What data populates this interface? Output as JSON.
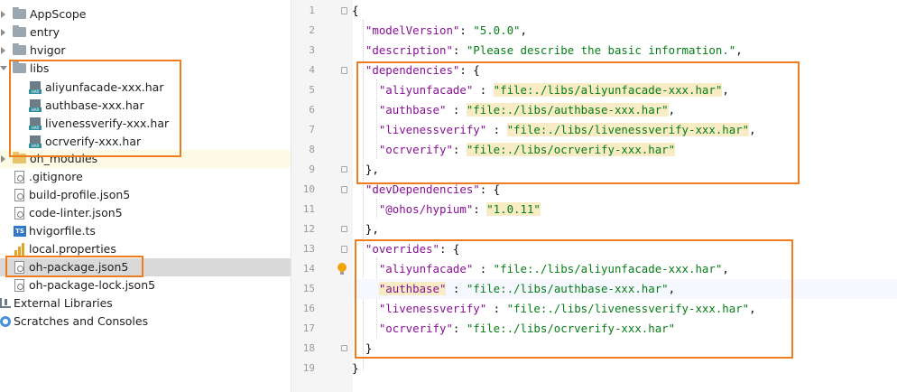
{
  "project_tree": {
    "items": [
      {
        "label": "AppScope",
        "icon": "folder-icon",
        "expander": "collapsed"
      },
      {
        "label": "entry",
        "icon": "folder-icon",
        "expander": "collapsed"
      },
      {
        "label": "hvigor",
        "icon": "folder-icon",
        "expander": "collapsed"
      },
      {
        "label": "libs",
        "icon": "folder-icon",
        "expander": "expanded"
      },
      {
        "label": "aliyunfacade-xxx.har",
        "icon": "har-file-icon"
      },
      {
        "label": "authbase-xxx.har",
        "icon": "har-file-icon"
      },
      {
        "label": "livenessverify-xxx.har",
        "icon": "har-file-icon"
      },
      {
        "label": "ocrverify-xxx.har",
        "icon": "har-file-icon"
      },
      {
        "label": "oh_modules",
        "icon": "folder-icon",
        "expander": "collapsed"
      },
      {
        "label": ".gitignore",
        "icon": "config-file-icon"
      },
      {
        "label": "build-profile.json5",
        "icon": "config-file-icon"
      },
      {
        "label": "code-linter.json5",
        "icon": "config-file-icon"
      },
      {
        "label": "hvigorfile.ts",
        "icon": "typescript-file-icon"
      },
      {
        "label": "local.properties",
        "icon": "properties-file-icon"
      },
      {
        "label": "oh-package.json5",
        "icon": "config-file-icon",
        "selected": true
      },
      {
        "label": "oh-package-lock.json5",
        "icon": "config-file-icon"
      },
      {
        "label": "External Libraries",
        "icon": "libraries-icon"
      },
      {
        "label": "Scratches and Consoles",
        "icon": "scratches-icon"
      }
    ]
  },
  "editor": {
    "line_numbers": [
      "1",
      "2",
      "3",
      "4",
      "5",
      "6",
      "7",
      "8",
      "9",
      "10",
      "11",
      "12",
      "13",
      "14",
      "15",
      "16",
      "17",
      "18",
      "19"
    ],
    "lines": [
      {
        "tokens": [
          {
            "t": "p",
            "v": "{"
          }
        ]
      },
      {
        "tokens": [
          {
            "t": "p",
            "v": "  "
          },
          {
            "t": "k",
            "v": "\"modelVersion\""
          },
          {
            "t": "p",
            "v": ": "
          },
          {
            "t": "s",
            "v": "\"5.0.0\""
          },
          {
            "t": "p",
            "v": ","
          }
        ]
      },
      {
        "tokens": [
          {
            "t": "p",
            "v": "  "
          },
          {
            "t": "k",
            "v": "\"description\""
          },
          {
            "t": "p",
            "v": ": "
          },
          {
            "t": "s",
            "v": "\"Please describe the basic information.\""
          },
          {
            "t": "p",
            "v": ","
          }
        ]
      },
      {
        "tokens": [
          {
            "t": "p",
            "v": "  "
          },
          {
            "t": "k",
            "v": "\"dependencies\""
          },
          {
            "t": "p",
            "v": ": {"
          }
        ]
      },
      {
        "tokens": [
          {
            "t": "p",
            "v": "    "
          },
          {
            "t": "k",
            "v": "\"aliyunfacade\""
          },
          {
            "t": "p",
            "v": " : "
          },
          {
            "t": "s",
            "v": "\"file:./libs/aliyunfacade-xxx.har\"",
            "h": true
          },
          {
            "t": "p",
            "v": ","
          }
        ]
      },
      {
        "tokens": [
          {
            "t": "p",
            "v": "    "
          },
          {
            "t": "k",
            "v": "\"authbase\""
          },
          {
            "t": "p",
            "v": " : "
          },
          {
            "t": "s",
            "v": "\"file:./libs/authbase-xxx.har\"",
            "h": true
          },
          {
            "t": "p",
            "v": ","
          }
        ]
      },
      {
        "tokens": [
          {
            "t": "p",
            "v": "    "
          },
          {
            "t": "k",
            "v": "\"livenessverify\""
          },
          {
            "t": "p",
            "v": " : "
          },
          {
            "t": "s",
            "v": "\"file:./libs/livenessverify-xxx.har\"",
            "h": true
          },
          {
            "t": "p",
            "v": ","
          }
        ]
      },
      {
        "tokens": [
          {
            "t": "p",
            "v": "    "
          },
          {
            "t": "k",
            "v": "\"ocrverify\""
          },
          {
            "t": "p",
            "v": ": "
          },
          {
            "t": "s",
            "v": "\"file:./libs/ocrverify-xxx.har\"",
            "h": true
          }
        ]
      },
      {
        "tokens": [
          {
            "t": "p",
            "v": "  },"
          }
        ]
      },
      {
        "tokens": [
          {
            "t": "p",
            "v": "  "
          },
          {
            "t": "k",
            "v": "\"devDependencies\""
          },
          {
            "t": "p",
            "v": ": {"
          }
        ]
      },
      {
        "tokens": [
          {
            "t": "p",
            "v": "    "
          },
          {
            "t": "k",
            "v": "\"@ohos/hypium\""
          },
          {
            "t": "p",
            "v": ": "
          },
          {
            "t": "s",
            "v": "\"1.0.11\"",
            "h": true
          }
        ]
      },
      {
        "tokens": [
          {
            "t": "p",
            "v": "  },"
          }
        ]
      },
      {
        "tokens": [
          {
            "t": "p",
            "v": "  "
          },
          {
            "t": "k",
            "v": "\"overrides\""
          },
          {
            "t": "p",
            "v": ": {"
          }
        ]
      },
      {
        "tokens": [
          {
            "t": "p",
            "v": "    "
          },
          {
            "t": "k",
            "v": "\"aliyunfacade\""
          },
          {
            "t": "p",
            "v": " : "
          },
          {
            "t": "s",
            "v": "\"file:./libs/aliyunfacade-xxx.har\""
          },
          {
            "t": "p",
            "v": ","
          }
        ]
      },
      {
        "tokens": [
          {
            "t": "p",
            "v": "    "
          },
          {
            "t": "k",
            "v": "\"authbase\"",
            "h": true
          },
          {
            "t": "p",
            "v": " : "
          },
          {
            "t": "s",
            "v": "\"file:./libs/authbase-xxx.har\""
          },
          {
            "t": "p",
            "v": ","
          }
        ]
      },
      {
        "tokens": [
          {
            "t": "p",
            "v": "    "
          },
          {
            "t": "k",
            "v": "\"livenessverify\""
          },
          {
            "t": "p",
            "v": " : "
          },
          {
            "t": "s",
            "v": "\"file:./libs/livenessverify-xxx.har\""
          },
          {
            "t": "p",
            "v": ","
          }
        ]
      },
      {
        "tokens": [
          {
            "t": "p",
            "v": "    "
          },
          {
            "t": "k",
            "v": "\"ocrverify\""
          },
          {
            "t": "p",
            "v": ": "
          },
          {
            "t": "s",
            "v": "\"file:./libs/ocrverify-xxx.har\""
          }
        ]
      },
      {
        "tokens": [
          {
            "t": "p",
            "v": "  }"
          }
        ]
      },
      {
        "tokens": [
          {
            "t": "p",
            "v": "}"
          }
        ]
      }
    ]
  },
  "colors": {
    "annotation_border": "#f07c20",
    "json_key": "#871094",
    "json_string": "#067d17",
    "highlight": "#f7ecc5",
    "selection": "#d9d9d9"
  }
}
